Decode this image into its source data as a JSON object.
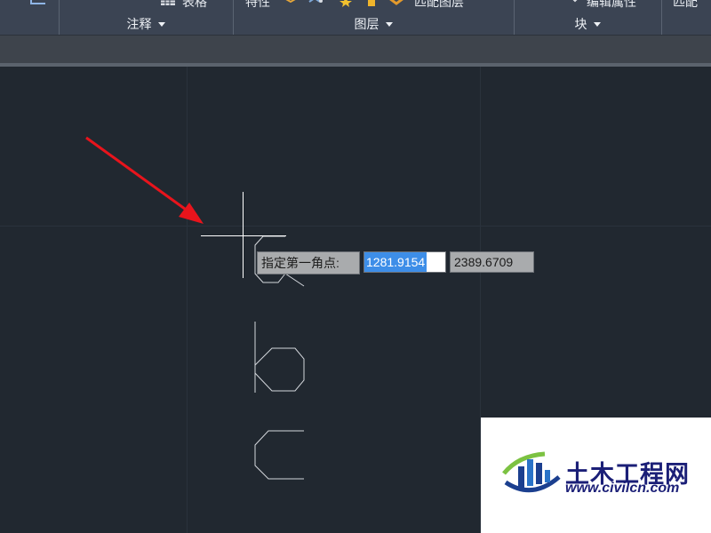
{
  "ribbon": {
    "cut_labels": {
      "table": "表格",
      "attributes": "特性",
      "match_layer": "匹配图层",
      "edit_attributes": "编辑属性",
      "match": "匹配"
    },
    "panels": [
      {
        "label": "注释"
      },
      {
        "label": "图层"
      },
      {
        "label": "块"
      }
    ]
  },
  "dynamic_input": {
    "prompt": "指定第一角点:",
    "x_value": "1281.9154",
    "y_value": "2389.6709"
  },
  "watermark": {
    "logo_text": "土木工程网",
    "url": "www.civilcn.com"
  },
  "colors": {
    "canvas_bg": "#212830",
    "ribbon_bg": "#3b4453",
    "arrow": "#e8141c",
    "selection": "#3d8ee8",
    "watermark_blue": "#1b1f77"
  }
}
